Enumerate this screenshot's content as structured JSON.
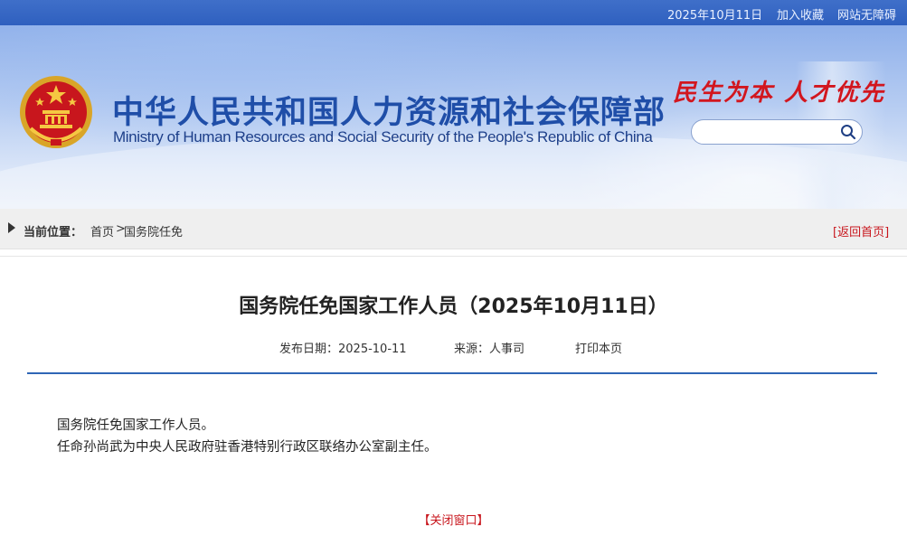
{
  "topbar": {
    "date": "2025年10月11日",
    "add_favorite": "加入收藏",
    "accessibility": "网站无障碍"
  },
  "header": {
    "title_cn": "中华人民共和国人力资源和社会保障部",
    "title_en": "Ministry of Human Resources and Social Security of the People's Republic of China",
    "slogan": "民生为本 人才优先",
    "search": {
      "placeholder": "",
      "value": ""
    },
    "icons": {
      "emblem": "national-emblem",
      "search": "magnifier-icon"
    }
  },
  "breadcrumb": {
    "label": "当前位置：",
    "home": "首页",
    "separator": ">",
    "section": "国务院任免",
    "back_home": "[返回首页]"
  },
  "article": {
    "title": "国务院任免国家工作人员（2025年10月11日）",
    "publish_date": "发布日期：2025-10-11",
    "source": "来源：人事司",
    "print": "打印本页",
    "paragraphs": [
      "国务院任免国家工作人员。",
      "任命孙尚武为中央人民政府驻香港特别行政区联络办公室副主任。"
    ],
    "close": "【关闭窗口】"
  },
  "colors": {
    "brand_blue": "#1f4ea8",
    "accent_red": "#c8161d",
    "rule_blue": "#2f66b6"
  }
}
